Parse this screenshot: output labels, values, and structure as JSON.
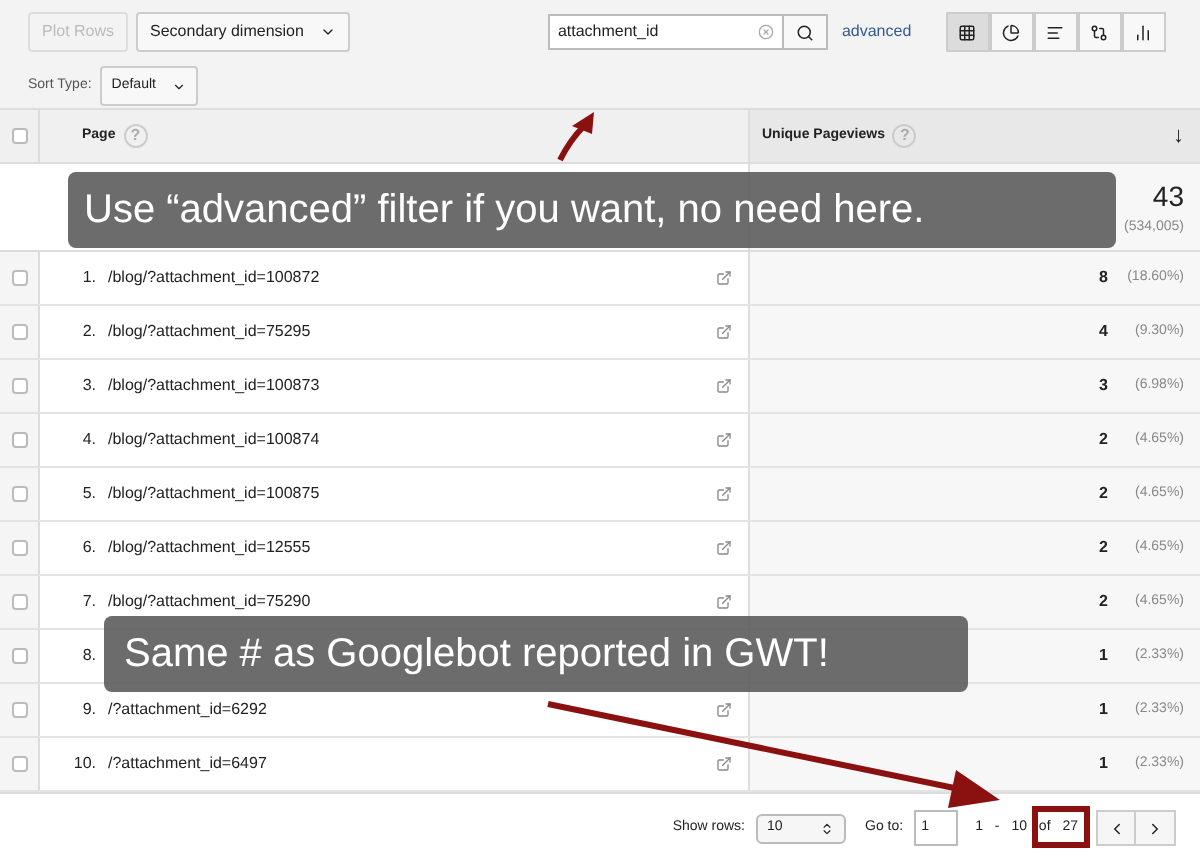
{
  "toolbar": {
    "plot_rows": {
      "label": "Plot Rows",
      "disabled": true
    },
    "secondary_dimension": "Secondary dimension",
    "search": {
      "value": "attachment_id"
    },
    "advanced_link": "advanced",
    "views": [
      {
        "kind": "table",
        "selected": true
      },
      {
        "kind": "pie",
        "selected": false
      },
      {
        "kind": "bars",
        "selected": false
      },
      {
        "kind": "compare",
        "selected": false
      },
      {
        "kind": "pivot",
        "selected": false
      }
    ],
    "sort_type": {
      "label": "Sort Type:",
      "value": "Default"
    }
  },
  "table": {
    "select_all": {
      "checked": false
    },
    "columns": [
      {
        "label": "Page",
        "help": "?"
      },
      {
        "label": "Unique Pageviews",
        "help": "?",
        "sort": "↓"
      }
    ],
    "total": {
      "value": "43",
      "share": "(534,005)"
    },
    "rows": [
      {
        "index": "1.",
        "page": "/blog/?attachment_id=100872",
        "checked": false,
        "value": "8",
        "share": "(18.60%)"
      },
      {
        "index": "2.",
        "page": "/blog/?attachment_id=75295",
        "checked": false,
        "value": "4",
        "share": "(9.30%)"
      },
      {
        "index": "3.",
        "page": "/blog/?attachment_id=100873",
        "checked": false,
        "value": "3",
        "share": "(6.98%)"
      },
      {
        "index": "4.",
        "page": "/blog/?attachment_id=100874",
        "checked": false,
        "value": "2",
        "share": "(4.65%)"
      },
      {
        "index": "5.",
        "page": "/blog/?attachment_id=100875",
        "checked": false,
        "value": "2",
        "share": "(4.65%)"
      },
      {
        "index": "6.",
        "page": "/blog/?attachment_id=12555",
        "checked": false,
        "value": "2",
        "share": "(4.65%)"
      },
      {
        "index": "7.",
        "page": "/blog/?attachment_id=75290",
        "checked": false,
        "value": "2",
        "share": "(4.65%)"
      },
      {
        "index": "8.",
        "checked": false,
        "value": "1",
        "share": "(2.33%)"
      },
      {
        "index": "9.",
        "page": "/?attachment_id=6292",
        "checked": false,
        "value": "1",
        "share": "(2.33%)"
      },
      {
        "index": "10.",
        "page": "/?attachment_id=6497",
        "checked": false,
        "value": "1",
        "share": "(2.33%)"
      }
    ]
  },
  "footer": {
    "show_rows_label": "Show rows:",
    "show_rows": "10",
    "goto_label": "Go to:",
    "goto": "1",
    "range": "1 - 10 of 27"
  },
  "annotations": [
    {
      "text": "Use “advanced” filter if you want, no need here."
    },
    {
      "text": "Same # as Googlebot reported in GWT!"
    }
  ]
}
